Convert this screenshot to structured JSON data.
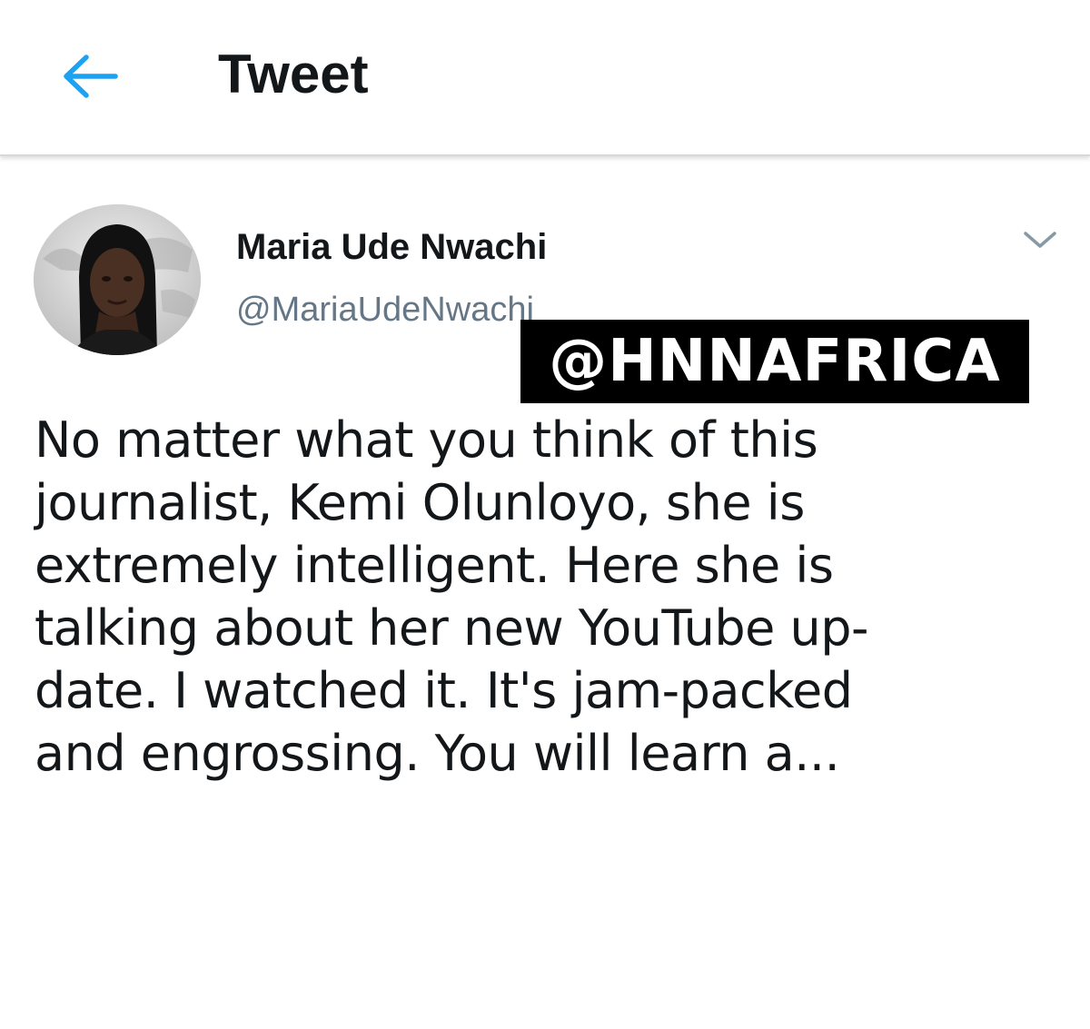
{
  "header": {
    "back_icon": "arrow-left-icon",
    "title": "Tweet"
  },
  "colors": {
    "accent": "#1da1f2",
    "text_primary": "#14171a",
    "text_secondary": "#657786",
    "watermark_bg": "#000000"
  },
  "tweet": {
    "author": {
      "display_name": "Maria Ude Nwachi",
      "handle": "@MariaUdeNwachi",
      "avatar_icon": "profile-photo"
    },
    "caret_icon": "chevron-down-icon",
    "text_lines": [
      "No matter what you think of this",
      "journalist, Kemi Olunloyo, she is",
      "extremely intelligent. Here she is",
      "talking about her new YouTube up-",
      "date. I watched it. It's jam-packed",
      "and engrossing. You will learn a..."
    ]
  },
  "watermark": {
    "text": "@HNNAFRICA"
  }
}
